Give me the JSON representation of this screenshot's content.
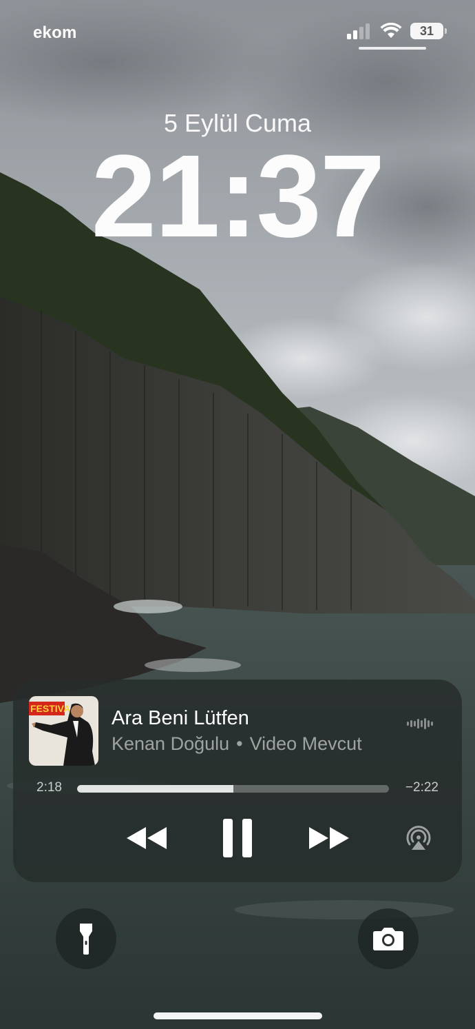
{
  "status_bar": {
    "carrier": "ekom",
    "battery_level": "31",
    "signal_bars_active": 2,
    "signal_bars_total": 4
  },
  "lock_screen": {
    "date": "5 Eylül Cuma",
    "time": "21:37"
  },
  "now_playing": {
    "title": "Ara Beni Lütfen",
    "artist": "Kenan Doğulu",
    "separator": "•",
    "extra": "Video Mevcut",
    "album_art_text": "FESTIVAL",
    "elapsed": "2:18",
    "remaining": "−2:22",
    "progress_fraction": 0.5
  },
  "icons": {
    "signal": "cellular-signal-icon",
    "wifi": "wifi-icon",
    "battery": "battery-icon",
    "audio": "audio-waveform-icon",
    "rewind": "rewind-icon",
    "pause": "pause-icon",
    "forward": "fast-forward-icon",
    "airplay": "airplay-icon",
    "flashlight": "flashlight-icon",
    "camera": "camera-icon"
  },
  "colors": {
    "widget_bg": "#262d2c",
    "text_primary": "#ffffff",
    "text_secondary": "#8e9492",
    "album_red": "#d5261b"
  }
}
